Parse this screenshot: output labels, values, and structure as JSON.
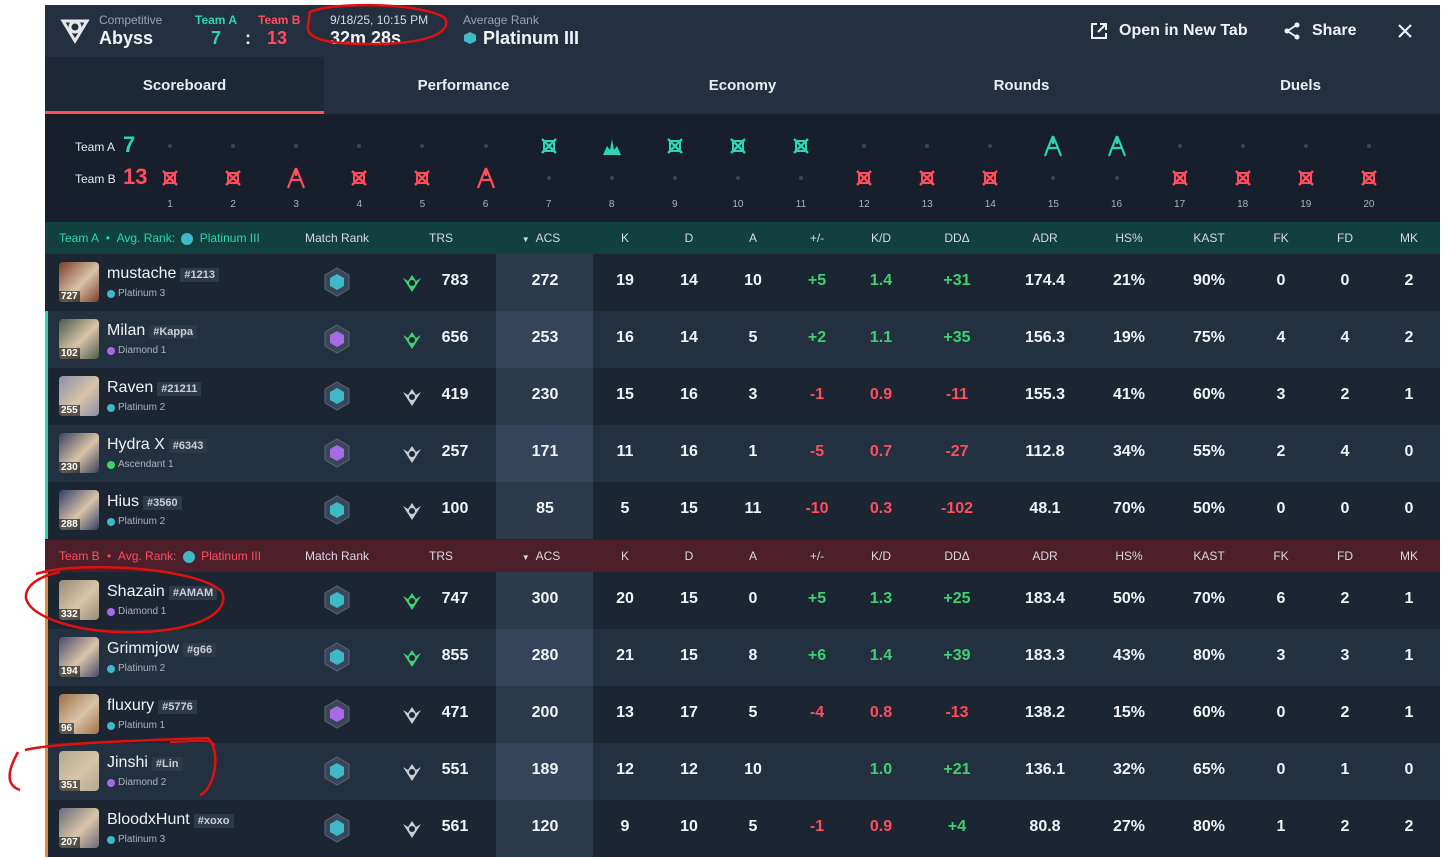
{
  "header": {
    "mode": "Competitive",
    "map": "Abyss",
    "team_a_label": "Team A",
    "team_b_label": "Team B",
    "team_a_score": "7",
    "team_b_score": "13",
    "score_sep": ":",
    "date": "9/18/25, 10:15 PM",
    "duration": "32m 28s",
    "avg_rank_label": "Average Rank",
    "avg_rank": "Platinum III",
    "open_new_tab": "Open in New Tab",
    "share": "Share"
  },
  "tabs": [
    "Scoreboard",
    "Performance",
    "Economy",
    "Rounds",
    "Duels"
  ],
  "timeline": {
    "team_a_label": "Team A",
    "team_b_label": "Team B",
    "team_a_score": "7",
    "team_b_score": "13",
    "rounds": [
      {
        "n": "1",
        "winner": "B",
        "icon": "elimination-icon"
      },
      {
        "n": "2",
        "winner": "B",
        "icon": "elimination-icon"
      },
      {
        "n": "3",
        "winner": "B",
        "icon": "spike-defuse-icon"
      },
      {
        "n": "4",
        "winner": "B",
        "icon": "elimination-icon"
      },
      {
        "n": "5",
        "winner": "B",
        "icon": "elimination-icon"
      },
      {
        "n": "6",
        "winner": "B",
        "icon": "spike-defuse-icon"
      },
      {
        "n": "7",
        "winner": "A",
        "icon": "elimination-icon"
      },
      {
        "n": "8",
        "winner": "A",
        "icon": "spike-detonate-icon"
      },
      {
        "n": "9",
        "winner": "A",
        "icon": "elimination-icon"
      },
      {
        "n": "10",
        "winner": "A",
        "icon": "elimination-icon"
      },
      {
        "n": "11",
        "winner": "A",
        "icon": "elimination-icon"
      },
      {
        "n": "12",
        "winner": "B",
        "icon": "elimination-icon"
      },
      {
        "n": "13",
        "winner": "B",
        "icon": "elimination-icon"
      },
      {
        "n": "14",
        "winner": "B",
        "icon": "elimination-icon"
      },
      {
        "n": "15",
        "winner": "A",
        "icon": "spike-defuse-icon"
      },
      {
        "n": "16",
        "winner": "A",
        "icon": "spike-defuse-icon"
      },
      {
        "n": "17",
        "winner": "B",
        "icon": "elimination-icon"
      },
      {
        "n": "18",
        "winner": "B",
        "icon": "elimination-icon"
      },
      {
        "n": "19",
        "winner": "B",
        "icon": "elimination-icon"
      },
      {
        "n": "20",
        "winner": "B",
        "icon": "elimination-icon"
      }
    ]
  },
  "columns": [
    "Match Rank",
    "TRS",
    "ACS",
    "K",
    "D",
    "A",
    "+/-",
    "K/D",
    "DDΔ",
    "ADR",
    "HS%",
    "KAST",
    "FK",
    "FD",
    "MK"
  ],
  "team_a": {
    "title": "Team A",
    "sep": "•",
    "avg_label": "Avg. Rank:",
    "avg_rank": "Platinum III",
    "players": [
      {
        "name": "mustache",
        "tag": "#1213",
        "rank": "Platinum 3",
        "level": "727",
        "trs": "783",
        "acs": "272",
        "k": "19",
        "d": "14",
        "a": "10",
        "pm": "+5",
        "kd": "1.4",
        "ddd": "+31",
        "adr": "174.4",
        "hs": "21%",
        "kast": "90%",
        "fk": "0",
        "fd": "0",
        "mk": "2",
        "mrank": "plat"
      },
      {
        "name": "Milan",
        "tag": "#Kappa",
        "rank": "Diamond 1",
        "level": "102",
        "trs": "656",
        "acs": "253",
        "k": "16",
        "d": "14",
        "a": "5",
        "pm": "+2",
        "kd": "1.1",
        "ddd": "+35",
        "adr": "156.3",
        "hs": "19%",
        "kast": "75%",
        "fk": "4",
        "fd": "4",
        "mk": "2",
        "mrank": "dia"
      },
      {
        "name": "Raven",
        "tag": "#21211",
        "rank": "Platinum 2",
        "level": "255",
        "trs": "419",
        "acs": "230",
        "k": "15",
        "d": "16",
        "a": "3",
        "pm": "-1",
        "kd": "0.9",
        "ddd": "-11",
        "adr": "155.3",
        "hs": "41%",
        "kast": "60%",
        "fk": "3",
        "fd": "2",
        "mk": "1",
        "mrank": "plat"
      },
      {
        "name": "Hydra X",
        "tag": "#6343",
        "rank": "Ascendant 1",
        "level": "230",
        "trs": "257",
        "acs": "171",
        "k": "11",
        "d": "16",
        "a": "1",
        "pm": "-5",
        "kd": "0.7",
        "ddd": "-27",
        "adr": "112.8",
        "hs": "34%",
        "kast": "55%",
        "fk": "2",
        "fd": "4",
        "mk": "0",
        "mrank": "dia"
      },
      {
        "name": "Hius",
        "tag": "#3560",
        "rank": "Platinum 2",
        "level": "288",
        "trs": "100",
        "acs": "85",
        "k": "5",
        "d": "15",
        "a": "11",
        "pm": "-10",
        "kd": "0.3",
        "ddd": "-102",
        "adr": "48.1",
        "hs": "70%",
        "kast": "50%",
        "fk": "0",
        "fd": "0",
        "mk": "0",
        "mrank": "plat"
      }
    ]
  },
  "team_b": {
    "title": "Team B",
    "sep": "•",
    "avg_label": "Avg. Rank:",
    "avg_rank": "Platinum III",
    "players": [
      {
        "name": "Shazain",
        "tag": "#AMAM",
        "rank": "Diamond 1",
        "level": "332",
        "trs": "747",
        "acs": "300",
        "k": "20",
        "d": "15",
        "a": "0",
        "pm": "+5",
        "kd": "1.3",
        "ddd": "+25",
        "adr": "183.4",
        "hs": "50%",
        "kast": "70%",
        "fk": "6",
        "fd": "2",
        "mk": "1",
        "mrank": "plat"
      },
      {
        "name": "Grimmjow",
        "tag": "#g66",
        "rank": "Platinum 2",
        "level": "194",
        "trs": "855",
        "acs": "280",
        "k": "21",
        "d": "15",
        "a": "8",
        "pm": "+6",
        "kd": "1.4",
        "ddd": "+39",
        "adr": "183.3",
        "hs": "43%",
        "kast": "80%",
        "fk": "3",
        "fd": "3",
        "mk": "1",
        "mrank": "plat"
      },
      {
        "name": "fluxury",
        "tag": "#5776",
        "rank": "Platinum 1",
        "level": "96",
        "trs": "471",
        "acs": "200",
        "k": "13",
        "d": "17",
        "a": "5",
        "pm": "-4",
        "kd": "0.8",
        "ddd": "-13",
        "adr": "138.2",
        "hs": "15%",
        "kast": "60%",
        "fk": "0",
        "fd": "2",
        "mk": "1",
        "mrank": "dia"
      },
      {
        "name": "Jinshi",
        "tag": "#Lin",
        "rank": "Diamond 2",
        "level": "351",
        "trs": "551",
        "acs": "189",
        "k": "12",
        "d": "12",
        "a": "10",
        "pm": "",
        "kd": "1.0",
        "ddd": "+21",
        "adr": "136.1",
        "hs": "32%",
        "kast": "65%",
        "fk": "0",
        "fd": "1",
        "mk": "0",
        "mrank": "plat"
      },
      {
        "name": "BloodxHunt",
        "tag": "#xoxo",
        "rank": "Platinum 3",
        "level": "207",
        "trs": "561",
        "acs": "120",
        "k": "9",
        "d": "10",
        "a": "5",
        "pm": "-1",
        "kd": "0.9",
        "ddd": "+4",
        "adr": "80.8",
        "hs": "27%",
        "kast": "80%",
        "fk": "1",
        "fd": "2",
        "mk": "2",
        "mrank": "plat"
      }
    ]
  },
  "colors": {
    "team_a": "#2ad6b6",
    "team_b": "#ff4d5e",
    "positive": "#3fd16f",
    "negative": "#ff4d5e",
    "platinum": "#3fb8c8",
    "diamond": "#a56be6",
    "annotation": "#e01010"
  }
}
